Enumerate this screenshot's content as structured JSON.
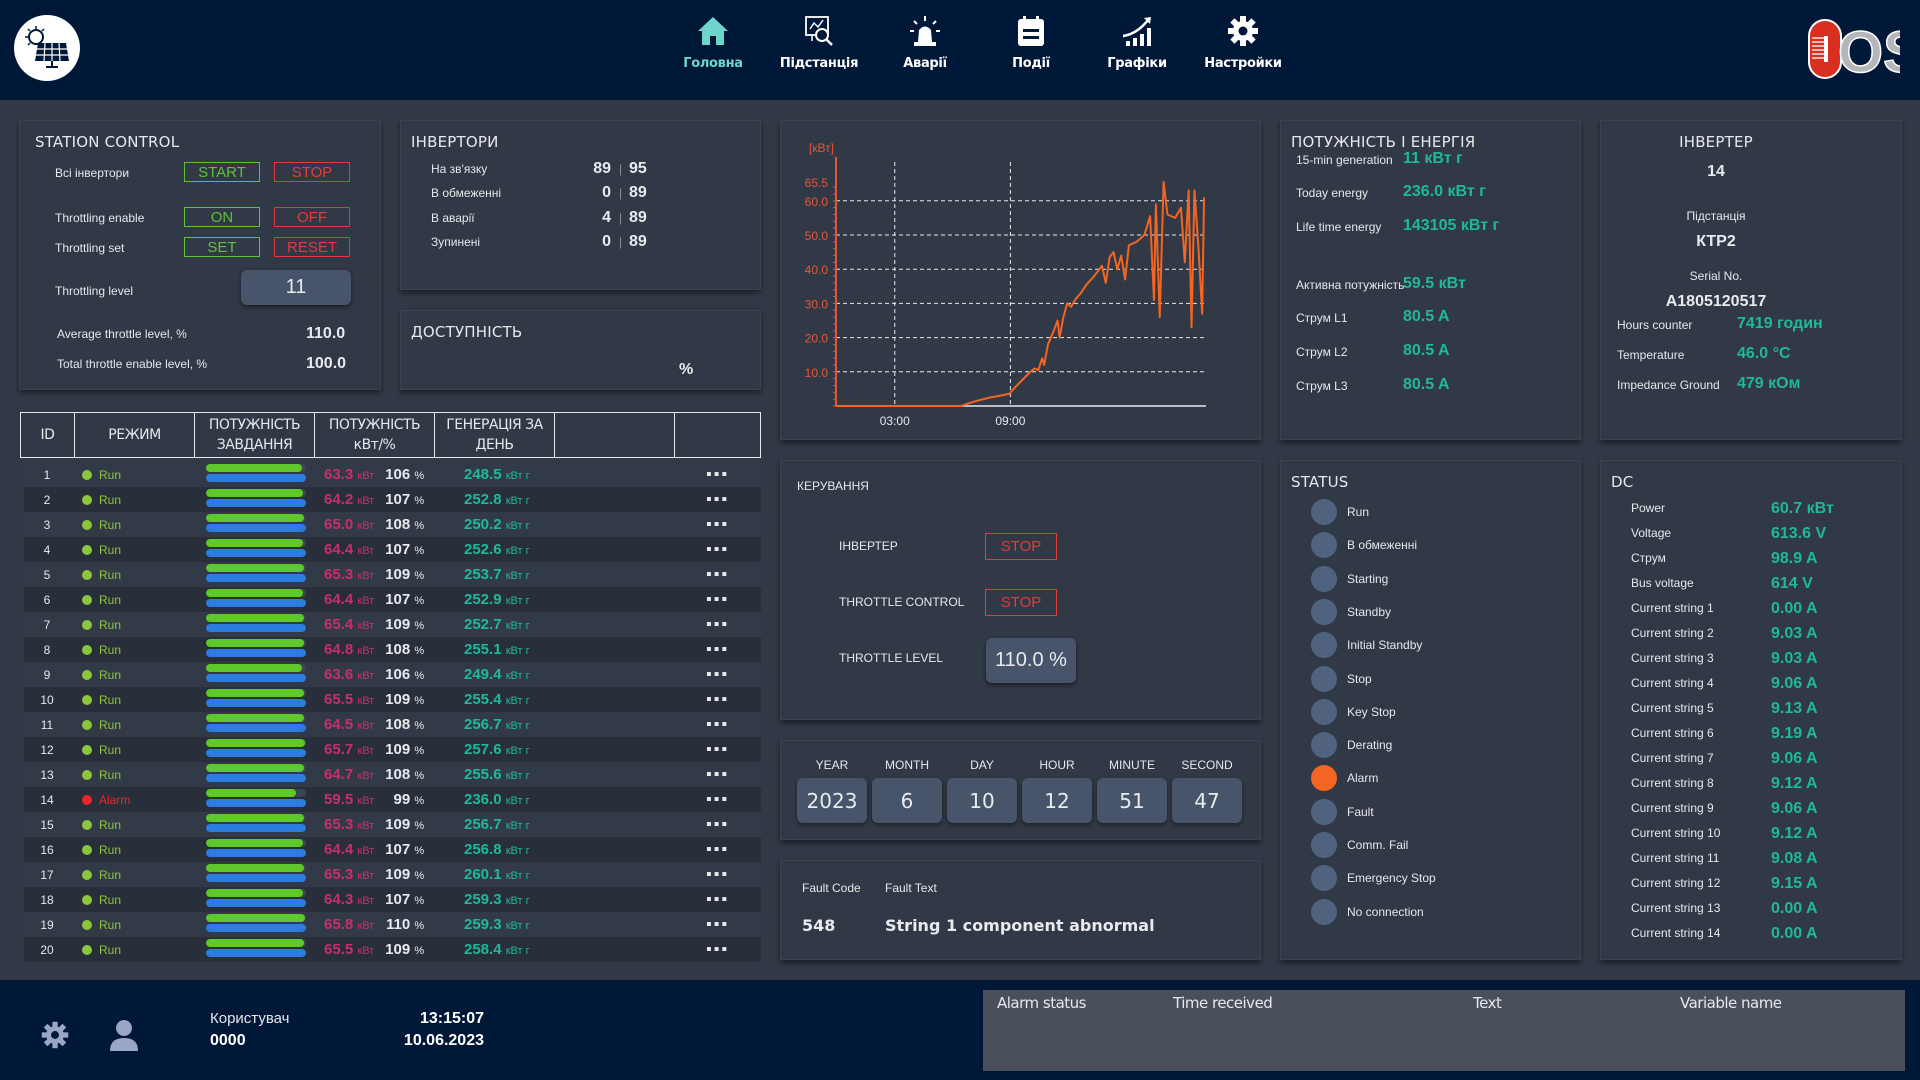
{
  "nav": {
    "items": [
      {
        "label": "Головна",
        "icon": "home-icon",
        "active": true
      },
      {
        "label": "Підстанція",
        "icon": "substation-monitor-icon"
      },
      {
        "label": "Аварії",
        "icon": "alarm-beacon-icon"
      },
      {
        "label": "Події",
        "icon": "events-calendar-icon"
      },
      {
        "label": "Графіки",
        "icon": "chart-growth-icon"
      },
      {
        "label": "Настройки",
        "icon": "gear-icon"
      }
    ]
  },
  "logos": {
    "left": "solar-panel-logo",
    "right_text": "OSS"
  },
  "station_control": {
    "title": "STATION CONTROL",
    "all_inverters_label": "Всі інвертори",
    "start": "START",
    "stop": "STOP",
    "throttling_enable_label": "Throttling enable",
    "on": "ON",
    "off": "OFF",
    "throttling_set_label": "Throttling set",
    "set": "SET",
    "reset": "RESET",
    "throttling_level_label": "Throttling level",
    "throttling_level_value": "11",
    "avg_label": "Average throttle level, %",
    "avg_value": "110.0",
    "total_label": "Total throttle enable level, %",
    "total_value": "100.0"
  },
  "inverters": {
    "title": "ІНВЕРТОРИ",
    "rows": [
      {
        "label": "На зв'язку",
        "a": "89",
        "b": "95"
      },
      {
        "label": "В обмеженні",
        "a": "0",
        "b": "89"
      },
      {
        "label": "В аварії",
        "a": "4",
        "b": "89"
      },
      {
        "label": "Зупинені",
        "a": "0",
        "b": "89"
      }
    ],
    "separator": "|"
  },
  "availability": {
    "title": "ДОСТУПНІСТЬ",
    "value": "",
    "unit": "%"
  },
  "table": {
    "headers": [
      "ID",
      "РЕЖИМ",
      "ПОТУЖНІСТЬ ЗАВДАННЯ",
      "ПОТУЖНІСТЬ кВт/%",
      "ГЕНЕРАЦІЯ ЗА ДЕНЬ",
      "",
      ""
    ],
    "kw_unit": "кВт",
    "pct_unit": "%",
    "gen_unit": "кВт г",
    "more": "▪▪▪",
    "rows": [
      {
        "id": "1",
        "mode": "Run",
        "status": "run",
        "task_fill": 0.96,
        "power_fill": 1.0,
        "kw": "63.3",
        "pct": "106",
        "gen": "248.5"
      },
      {
        "id": "2",
        "mode": "Run",
        "status": "run",
        "task_fill": 0.97,
        "power_fill": 1.0,
        "kw": "64.2",
        "pct": "107",
        "gen": "252.8"
      },
      {
        "id": "3",
        "mode": "Run",
        "status": "run",
        "task_fill": 0.98,
        "power_fill": 1.0,
        "kw": "65.0",
        "pct": "108",
        "gen": "250.2"
      },
      {
        "id": "4",
        "mode": "Run",
        "status": "run",
        "task_fill": 0.97,
        "power_fill": 1.0,
        "kw": "64.4",
        "pct": "107",
        "gen": "252.6"
      },
      {
        "id": "5",
        "mode": "Run",
        "status": "run",
        "task_fill": 0.98,
        "power_fill": 1.0,
        "kw": "65.3",
        "pct": "109",
        "gen": "253.7"
      },
      {
        "id": "6",
        "mode": "Run",
        "status": "run",
        "task_fill": 0.97,
        "power_fill": 1.0,
        "kw": "64.4",
        "pct": "107",
        "gen": "252.9"
      },
      {
        "id": "7",
        "mode": "Run",
        "status": "run",
        "task_fill": 0.98,
        "power_fill": 1.0,
        "kw": "65.4",
        "pct": "109",
        "gen": "252.7"
      },
      {
        "id": "8",
        "mode": "Run",
        "status": "run",
        "task_fill": 0.98,
        "power_fill": 1.0,
        "kw": "64.8",
        "pct": "108",
        "gen": "255.1"
      },
      {
        "id": "9",
        "mode": "Run",
        "status": "run",
        "task_fill": 0.96,
        "power_fill": 1.0,
        "kw": "63.6",
        "pct": "106",
        "gen": "249.4"
      },
      {
        "id": "10",
        "mode": "Run",
        "status": "run",
        "task_fill": 0.98,
        "power_fill": 1.0,
        "kw": "65.5",
        "pct": "109",
        "gen": "255.4"
      },
      {
        "id": "11",
        "mode": "Run",
        "status": "run",
        "task_fill": 0.98,
        "power_fill": 1.0,
        "kw": "64.5",
        "pct": "108",
        "gen": "256.7"
      },
      {
        "id": "12",
        "mode": "Run",
        "status": "run",
        "task_fill": 0.99,
        "power_fill": 1.0,
        "kw": "65.7",
        "pct": "109",
        "gen": "257.6"
      },
      {
        "id": "13",
        "mode": "Run",
        "status": "run",
        "task_fill": 0.98,
        "power_fill": 1.0,
        "kw": "64.7",
        "pct": "108",
        "gen": "255.6"
      },
      {
        "id": "14",
        "mode": "Alarm",
        "status": "alarm",
        "task_fill": 0.9,
        "power_fill": 1.0,
        "kw": "59.5",
        "pct": "99",
        "gen": "236.0"
      },
      {
        "id": "15",
        "mode": "Run",
        "status": "run",
        "task_fill": 0.98,
        "power_fill": 1.0,
        "kw": "65.3",
        "pct": "109",
        "gen": "256.7"
      },
      {
        "id": "16",
        "mode": "Run",
        "status": "run",
        "task_fill": 0.97,
        "power_fill": 1.0,
        "kw": "64.4",
        "pct": "107",
        "gen": "256.8"
      },
      {
        "id": "17",
        "mode": "Run",
        "status": "run",
        "task_fill": 0.98,
        "power_fill": 1.0,
        "kw": "65.3",
        "pct": "109",
        "gen": "260.1"
      },
      {
        "id": "18",
        "mode": "Run",
        "status": "run",
        "task_fill": 0.97,
        "power_fill": 1.0,
        "kw": "64.3",
        "pct": "107",
        "gen": "259.3"
      },
      {
        "id": "19",
        "mode": "Run",
        "status": "run",
        "task_fill": 0.99,
        "power_fill": 1.0,
        "kw": "65.8",
        "pct": "110",
        "gen": "259.3"
      },
      {
        "id": "20",
        "mode": "Run",
        "status": "run",
        "task_fill": 0.98,
        "power_fill": 1.0,
        "kw": "65.5",
        "pct": "109",
        "gen": "258.4"
      }
    ]
  },
  "chart_data": {
    "type": "line",
    "title": "",
    "ylabel": "[кВт]",
    "xlabel": "",
    "ylim": [
      0,
      65.5
    ],
    "y_ticks": [
      "10.0",
      "20.0",
      "30.0",
      "40.0",
      "50.0",
      "60.0",
      "65.5"
    ],
    "x_ticks": [
      "03:00",
      "09:00"
    ],
    "xlim_hours": [
      0,
      13.2
    ],
    "grid": true,
    "color": "#f26522",
    "points": [
      [
        0,
        0
      ],
      [
        6.5,
        0
      ],
      [
        7.0,
        1.0
      ],
      [
        7.5,
        1.8
      ],
      [
        8.0,
        2.5
      ],
      [
        8.5,
        3.0
      ],
      [
        9.0,
        3.6
      ],
      [
        9.3,
        5.5
      ],
      [
        9.6,
        7.2
      ],
      [
        10.0,
        9.5
      ],
      [
        10.3,
        11.0
      ],
      [
        10.5,
        10.5
      ],
      [
        10.7,
        14.0
      ],
      [
        10.8,
        12.0
      ],
      [
        11.0,
        18.0
      ],
      [
        11.3,
        22.0
      ],
      [
        11.5,
        25.0
      ],
      [
        11.6,
        20.0
      ],
      [
        11.8,
        26.0
      ],
      [
        12.0,
        30.0
      ],
      [
        12.2,
        29.0
      ],
      [
        12.4,
        31.0
      ],
      [
        12.7,
        33.0
      ],
      [
        13.0,
        35.5
      ],
      [
        13.4,
        38.0
      ],
      [
        13.8,
        41.0
      ],
      [
        14.0,
        36.0
      ],
      [
        14.2,
        43.5
      ],
      [
        14.4,
        45.0
      ],
      [
        14.6,
        40.0
      ],
      [
        14.8,
        44.0
      ],
      [
        15.0,
        37.0
      ],
      [
        15.2,
        47.0
      ],
      [
        15.6,
        48.0
      ],
      [
        16.0,
        50.0
      ],
      [
        16.3,
        55.5
      ],
      [
        16.5,
        31.0
      ],
      [
        16.6,
        59.0
      ],
      [
        16.8,
        26.0
      ],
      [
        17.0,
        65.5
      ],
      [
        17.2,
        56.0
      ],
      [
        17.6,
        55.0
      ],
      [
        17.9,
        58.0
      ],
      [
        18.1,
        42.0
      ],
      [
        18.3,
        63.0
      ],
      [
        18.45,
        23.0
      ],
      [
        18.6,
        63.0
      ],
      [
        18.8,
        47.0
      ],
      [
        19.0,
        27.0
      ],
      [
        19.1,
        61.0
      ]
    ]
  },
  "energy": {
    "title": "ПОТУЖНІСТЬ І ЕНЕРГІЯ",
    "rows": [
      {
        "label": "15-min generation",
        "value": "11 кВт г"
      },
      {
        "label": "Today energy",
        "value": "236.0 кВт г"
      },
      {
        "label": "Life time energy",
        "value": "143105 кВт г"
      },
      {
        "label": "Активна потужність",
        "value": "59.5 кВт"
      },
      {
        "label": "Струм L1",
        "value": "80.5 A"
      },
      {
        "label": "Струм L2",
        "value": "80.5 A"
      },
      {
        "label": "Струм L3",
        "value": "80.5 A"
      }
    ]
  },
  "inverter": {
    "title": "ІНВЕРТЕР",
    "number": "14",
    "substation_label": "Підстанція",
    "substation_value": "КТР2",
    "serial_label": "Serial No.",
    "serial_value": "A1805120517",
    "rows": [
      {
        "label": "Hours counter",
        "value": "7419 годин"
      },
      {
        "label": "Temperature",
        "value": "46.0 °C"
      },
      {
        "label": "Impedance Ground",
        "value": "479 кОм"
      }
    ]
  },
  "control": {
    "title": "КЕРУВАННЯ",
    "inverter_label": "ІНВЕРТЕР",
    "inverter_btn": "STOP",
    "throttle_label": "THROTTLE CONTROL",
    "throttle_btn": "STOP",
    "level_label": "THROTTLE LEVEL",
    "level_value": "110.0 %"
  },
  "datetime": {
    "fields": [
      {
        "label": "YEAR",
        "value": "2023"
      },
      {
        "label": "MONTH",
        "value": "6"
      },
      {
        "label": "DAY",
        "value": "10"
      },
      {
        "label": "HOUR",
        "value": "12"
      },
      {
        "label": "MINUTE",
        "value": "51"
      },
      {
        "label": "SECOND",
        "value": "47"
      }
    ]
  },
  "fault": {
    "code_label": "Fault Code",
    "text_label": "Fault Text",
    "code": "548",
    "text": "String 1 component abnormal"
  },
  "status": {
    "title": "STATUS",
    "active_color": "#f26522",
    "items": [
      {
        "label": "Run",
        "active": false
      },
      {
        "label": "В обмеженні",
        "active": false
      },
      {
        "label": "Starting",
        "active": false
      },
      {
        "label": "Standby",
        "active": false
      },
      {
        "label": "Initial Standby",
        "active": false
      },
      {
        "label": "Stop",
        "active": false
      },
      {
        "label": "Key Stop",
        "active": false
      },
      {
        "label": "Derating",
        "active": false
      },
      {
        "label": "Alarm",
        "active": true
      },
      {
        "label": "Fault",
        "active": false
      },
      {
        "label": "Comm. Fail",
        "active": false
      },
      {
        "label": "Emergency Stop",
        "active": false
      },
      {
        "label": "No connection",
        "active": false
      }
    ]
  },
  "dc": {
    "title": "DC",
    "rows": [
      {
        "label": "Power",
        "value": "60.7 кВт"
      },
      {
        "label": "Voltage",
        "value": "613.6 V"
      },
      {
        "label": "Струм",
        "value": "98.9 A"
      },
      {
        "label": "Bus voltage",
        "value": "614 V"
      },
      {
        "label": "Current string 1",
        "value": "0.00 A"
      },
      {
        "label": "Current string 2",
        "value": "9.03 A"
      },
      {
        "label": "Current string 3",
        "value": "9.03 A"
      },
      {
        "label": "Current string 4",
        "value": "9.06 A"
      },
      {
        "label": "Current string 5",
        "value": "9.13 A"
      },
      {
        "label": "Current string 6",
        "value": "9.19 A"
      },
      {
        "label": "Current string 7",
        "value": "9.06 A"
      },
      {
        "label": "Current string 8",
        "value": "9.12 A"
      },
      {
        "label": "Current string 9",
        "value": "9.06 A"
      },
      {
        "label": "Current string 10",
        "value": "9.12 A"
      },
      {
        "label": "Current string 11",
        "value": "9.08 A"
      },
      {
        "label": "Current string 12",
        "value": "9.15 A"
      },
      {
        "label": "Current string 13",
        "value": "0.00 A"
      },
      {
        "label": "Current string 14",
        "value": "0.00 A"
      }
    ]
  },
  "footer": {
    "user_label": "Користувач",
    "user_value": "0000",
    "time": "13:15:07",
    "date": "10.06.2023",
    "alarm_headers": [
      "Alarm status",
      "Time received",
      "Text",
      "Variable name"
    ]
  }
}
